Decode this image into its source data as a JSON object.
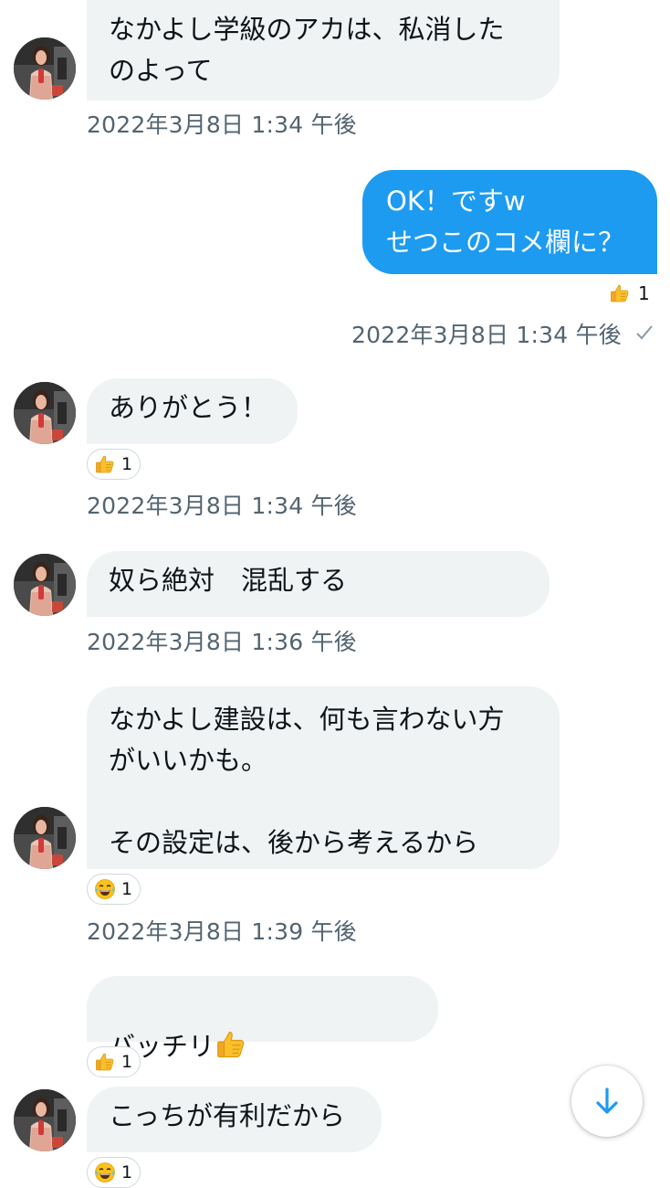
{
  "messages": [
    {
      "text": "なかよし学級のアカは、私消した\nのよって",
      "time": "2022年3月8日 1:34 午後"
    },
    {
      "text": "OK！ですw\nせつこのコメ欄に？",
      "time": "2022年3月8日 1:34 午後",
      "reaction_count": "1",
      "reaction_icon": "thumbs-up-icon",
      "status_icon": "checkmark-icon"
    },
    {
      "text": "ありがとう！",
      "time": "2022年3月8日 1:34 午後",
      "reaction_count": "1",
      "reaction_icon": "thumbs-up-icon"
    },
    {
      "text": "奴ら絶対　混乱する",
      "time": "2022年3月8日 1:36 午後"
    },
    {
      "text": "なかよし建設は、何も言わない方\nがいいかも。\n\nその設定は、後から考えるから",
      "time": "2022年3月8日 1:39 午後",
      "reaction_count": "1",
      "reaction_icon": "laughing-emoji-icon"
    },
    {
      "text": "バッチリ",
      "reaction_count": "1",
      "reaction_icon": "thumbs-up-icon"
    },
    {
      "text": "こっちが有利だから",
      "reaction_count": "1"
    }
  ],
  "colors": {
    "outgoing": "#1d9bf0",
    "incoming": "#eff3f4",
    "timestamp": "#536471",
    "accent": "#1d9bf0"
  },
  "scroll_button_icon": "arrow-down-icon"
}
